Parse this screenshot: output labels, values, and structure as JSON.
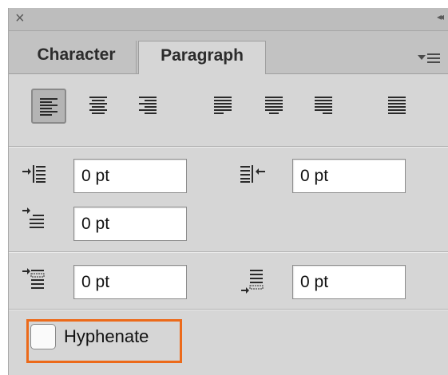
{
  "titlebar": {
    "close_glyph": "×",
    "collapse_glyph": "◂◂"
  },
  "tabs": [
    {
      "label": "Character",
      "active": false
    },
    {
      "label": "Paragraph",
      "active": true
    }
  ],
  "panel_menu_icon": "panel-menu-icon",
  "alignment_buttons": [
    {
      "name": "align-left",
      "selected": true
    },
    {
      "name": "align-center",
      "selected": false
    },
    {
      "name": "align-right",
      "selected": false
    },
    {
      "name": "justify-last-left",
      "selected": false
    },
    {
      "name": "justify-last-center",
      "selected": false
    },
    {
      "name": "justify-last-right",
      "selected": false
    },
    {
      "name": "justify-all",
      "selected": false
    }
  ],
  "fields": {
    "left_indent": "0 pt",
    "right_indent": "0 pt",
    "first_line_indent": "0 pt",
    "space_before": "0 pt",
    "space_after": "0 pt"
  },
  "hyphenate": {
    "label": "Hyphenate",
    "checked": false
  },
  "colors": {
    "highlight": "#ec6a1a",
    "panel": "#d6d6d6",
    "tabbar": "#c2c2c2"
  }
}
